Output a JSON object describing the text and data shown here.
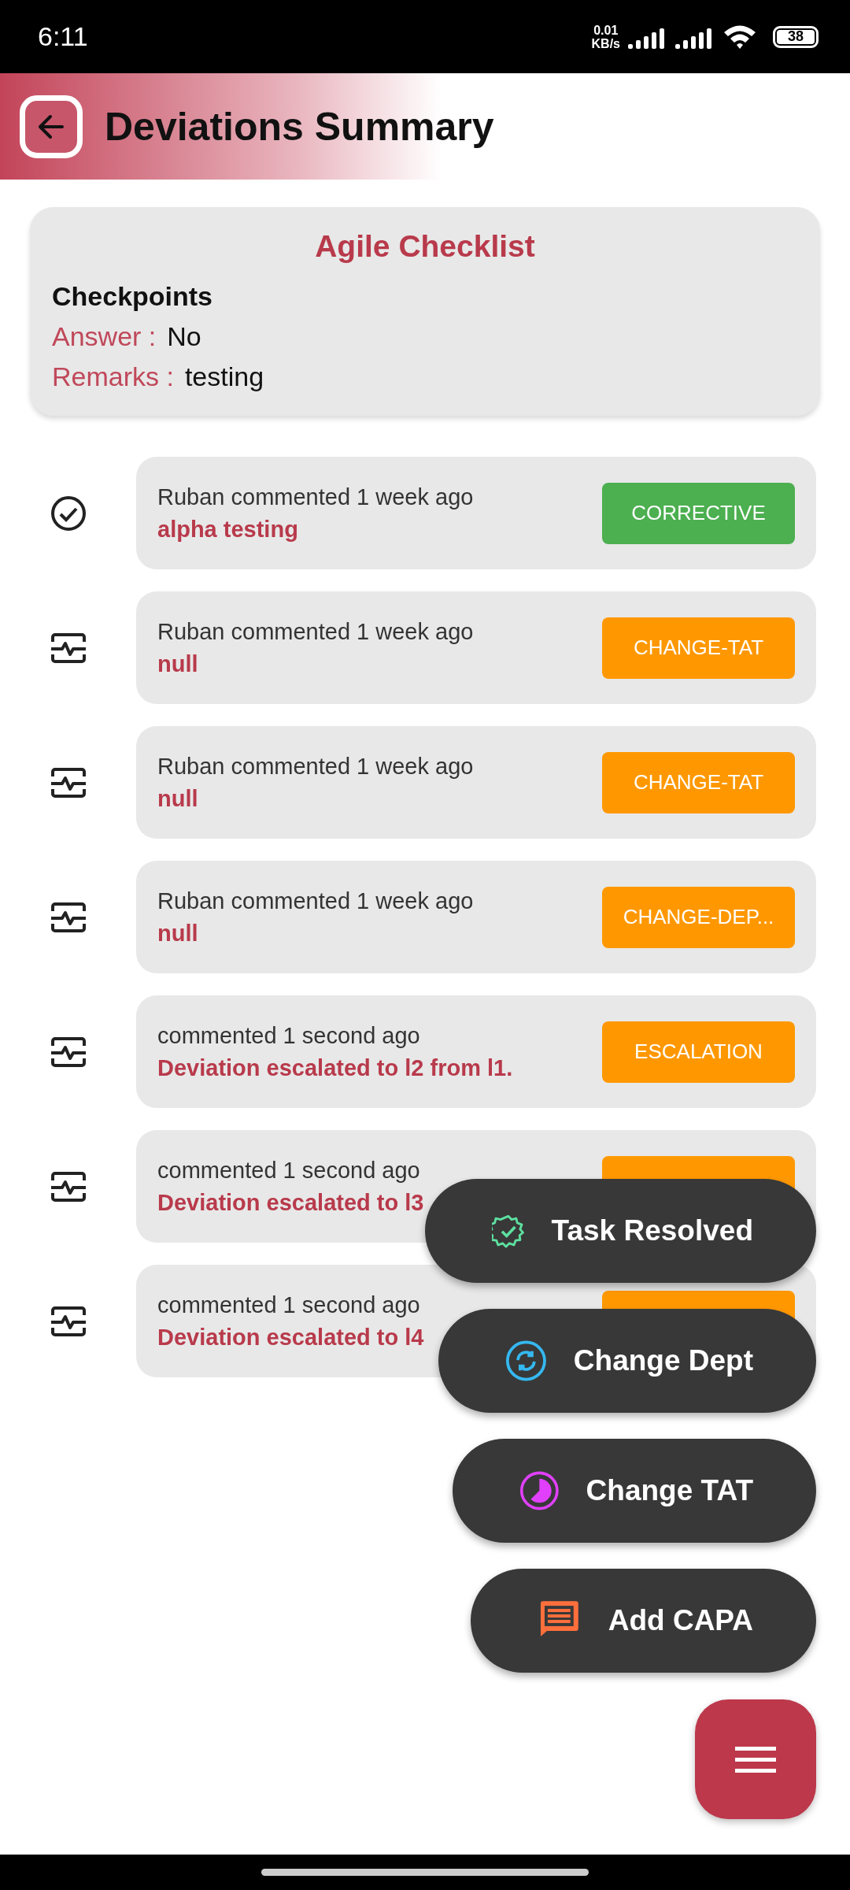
{
  "status_bar": {
    "time": "6:11",
    "net_speed": "0.01",
    "net_unit": "KB/s",
    "battery": "38"
  },
  "header": {
    "title": "Deviations Summary"
  },
  "checklist": {
    "title": "Agile Checklist",
    "heading": "Checkpoints",
    "fields": [
      {
        "label": "Answer :",
        "value": "No"
      },
      {
        "label": "Remarks :",
        "value": "testing"
      }
    ]
  },
  "comments": [
    {
      "kind": "check",
      "text": "Ruban commented 1 week ago",
      "message": "alpha testing",
      "badge": "CORRECTIVE",
      "color": "#4caf50"
    },
    {
      "kind": "pulse",
      "text": "Ruban commented 1 week ago",
      "message": "null",
      "badge": "CHANGE-TAT",
      "color": "#ff9800"
    },
    {
      "kind": "pulse",
      "text": "Ruban commented 1 week ago",
      "message": "null",
      "badge": "CHANGE-TAT",
      "color": "#ff9800"
    },
    {
      "kind": "pulse",
      "text": "Ruban commented 1 week ago",
      "message": "null",
      "badge": "CHANGE-DEP...",
      "color": "#ff9800"
    },
    {
      "kind": "pulse",
      "text": "commented 1 second ago",
      "message": "Deviation escalated to l2 from l1.",
      "badge": "ESCALATION",
      "color": "#ff9800"
    },
    {
      "kind": "pulse",
      "text": "commented 1 second ago",
      "message": "Deviation escalated to l3",
      "color": "#ff9800"
    },
    {
      "kind": "pulse",
      "text": "commented 1 second ago",
      "message": "Deviation escalated to l4",
      "color": "#ff9800"
    }
  ],
  "fab_menu": [
    {
      "kind": "resolved",
      "label": "Task Resolved"
    },
    {
      "kind": "dept",
      "label": "Change Dept"
    },
    {
      "kind": "tat",
      "label": "Change TAT"
    },
    {
      "kind": "capa",
      "label": "Add CAPA"
    }
  ]
}
